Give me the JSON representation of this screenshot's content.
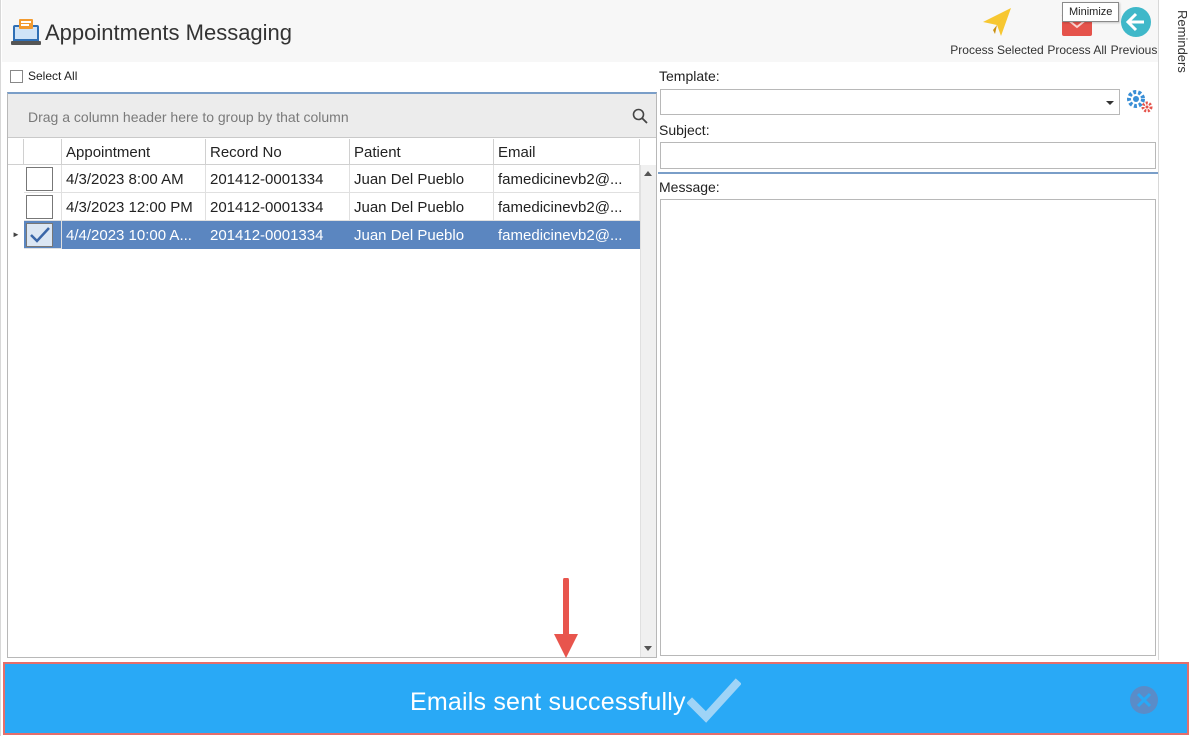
{
  "app": {
    "title": "Appointments Messaging"
  },
  "toolbar": {
    "process_selected_label": "Process Selected",
    "process_all_label": "Process All",
    "previous_label": "Previous",
    "tooltip": "Minimize"
  },
  "side_tab": {
    "label": "Reminders"
  },
  "grid": {
    "select_all_label": "Select All",
    "group_panel_text": "Drag a column header here to group by that column",
    "columns": [
      "Appointment",
      "Record No",
      "Patient",
      "Email"
    ],
    "rows": [
      {
        "checked": false,
        "selected": false,
        "appointment": "4/3/2023 8:00 AM",
        "record_no": "201412-0001334",
        "patient": "Juan Del Pueblo",
        "email": "famedicinevb2@..."
      },
      {
        "checked": false,
        "selected": false,
        "appointment": "4/3/2023 12:00 PM",
        "record_no": "201412-0001334",
        "patient": "Juan Del Pueblo",
        "email": "famedicinevb2@..."
      },
      {
        "checked": true,
        "selected": true,
        "appointment": "4/4/2023 10:00 A...",
        "record_no": "201412-0001334",
        "patient": "Juan Del Pueblo",
        "email": "famedicinevb2@..."
      }
    ]
  },
  "form": {
    "template_label": "Template:",
    "template_value": "",
    "subject_label": "Subject:",
    "subject_value": "",
    "message_label": "Message:",
    "message_value": ""
  },
  "notification": {
    "text": "Emails sent successfully"
  },
  "colors": {
    "toast_bg": "#29a9f6",
    "selected_row": "#5b86c0",
    "annotation_arrow": "#e8554d"
  }
}
